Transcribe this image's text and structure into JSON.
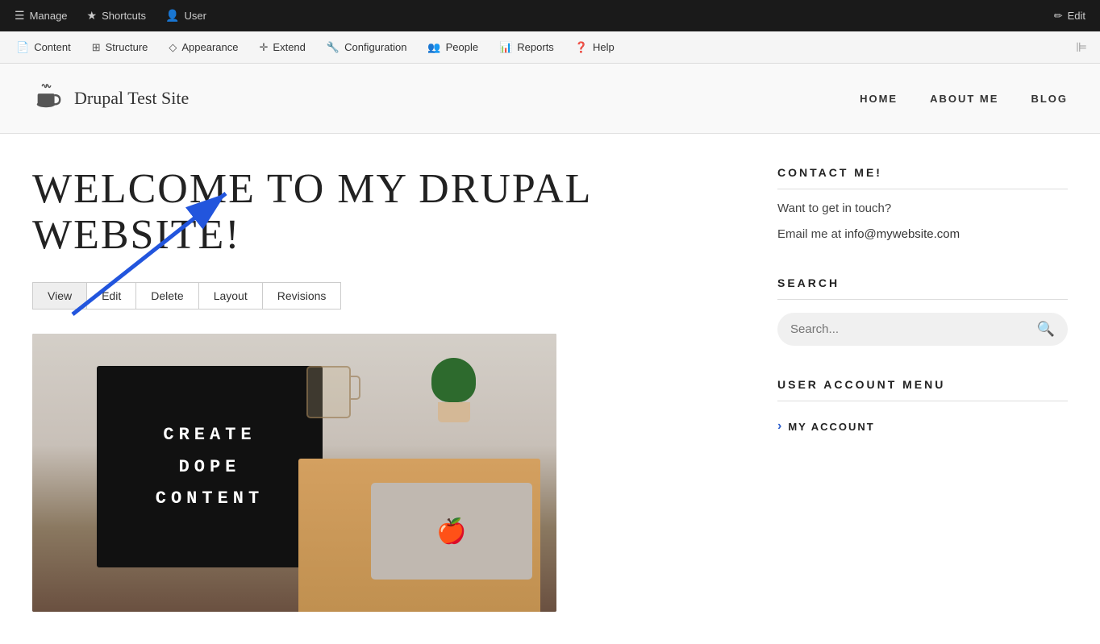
{
  "adminToolbar": {
    "manage": "Manage",
    "shortcuts": "Shortcuts",
    "user": "User",
    "edit": "Edit"
  },
  "adminMenu": {
    "items": [
      {
        "label": "Content",
        "icon": "📄"
      },
      {
        "label": "Structure",
        "icon": "⚙"
      },
      {
        "label": "Appearance",
        "icon": "🎨"
      },
      {
        "label": "Extend",
        "icon": "🔧"
      },
      {
        "label": "Configuration",
        "icon": "⚙"
      },
      {
        "label": "People",
        "icon": "👤"
      },
      {
        "label": "Reports",
        "icon": "📊"
      },
      {
        "label": "Help",
        "icon": "❓"
      }
    ]
  },
  "siteHeader": {
    "title": "Drupal Test Site",
    "nav": [
      {
        "label": "HOME"
      },
      {
        "label": "ABOUT ME"
      },
      {
        "label": "BLOG"
      }
    ]
  },
  "main": {
    "pageTitle": "WELCOME TO MY DRUPAL WEBSITE!",
    "tabs": [
      {
        "label": "View",
        "active": true
      },
      {
        "label": "Edit",
        "active": false
      },
      {
        "label": "Delete",
        "active": false
      },
      {
        "label": "Layout",
        "active": false
      },
      {
        "label": "Revisions",
        "active": false
      }
    ]
  },
  "sidebar": {
    "contact": {
      "title": "CONTACT ME!",
      "line1": "Want to get in touch?",
      "line2": "Email me at info@mywebsite.com"
    },
    "search": {
      "title": "SEARCH",
      "placeholder": "Search..."
    },
    "userMenu": {
      "title": "USER ACCOUNT MENU",
      "items": [
        {
          "label": "MY ACCOUNT"
        }
      ]
    }
  }
}
